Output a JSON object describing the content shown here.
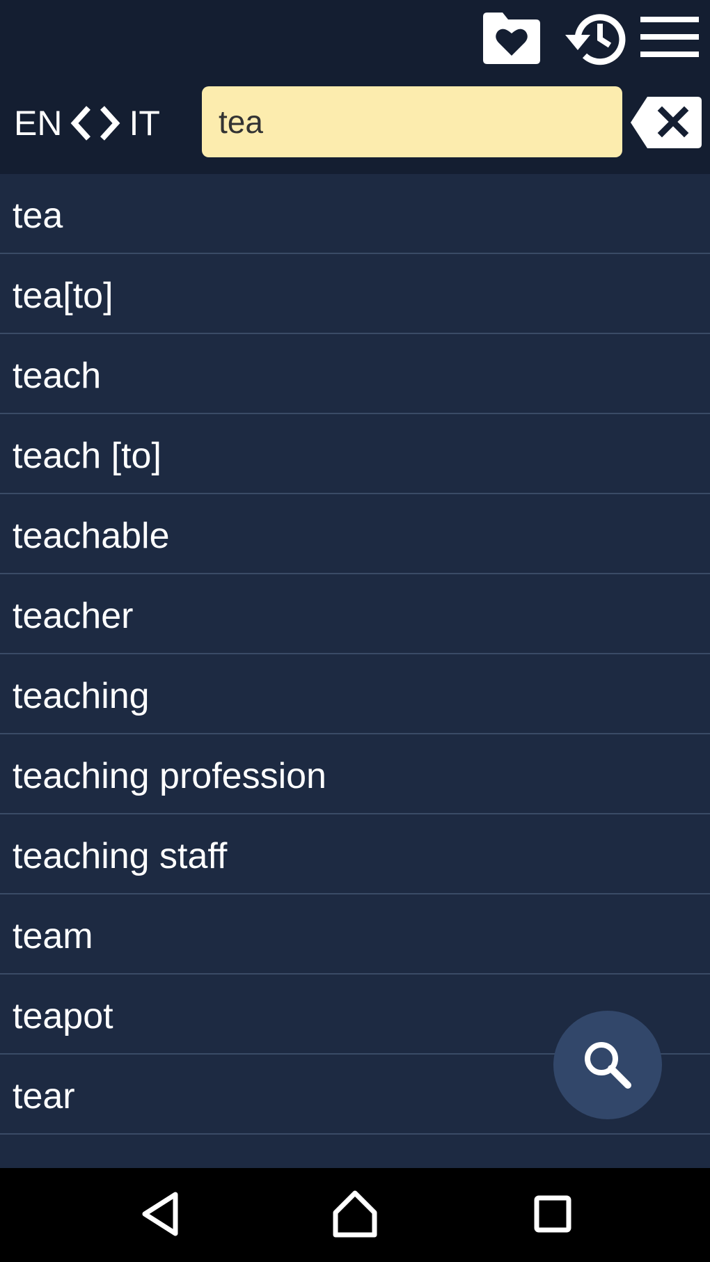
{
  "toolbar": {
    "icons": [
      "favorites-folder-icon",
      "history-icon",
      "menu-icon"
    ]
  },
  "language": {
    "from": "EN",
    "to": "IT"
  },
  "search": {
    "value": "tea"
  },
  "results": [
    "tea",
    "tea[to]",
    "teach",
    "teach [to]",
    "teachable",
    "teacher",
    "teaching",
    "teaching profession",
    "teaching staff",
    "team",
    "teapot",
    "tear"
  ],
  "navigation": {
    "icons": [
      "back-icon",
      "home-icon",
      "recents-icon"
    ]
  },
  "colors": {
    "background": "#1d2a42",
    "header": "#141e31",
    "search_field": "#fcecae",
    "fab": "#32476a"
  }
}
